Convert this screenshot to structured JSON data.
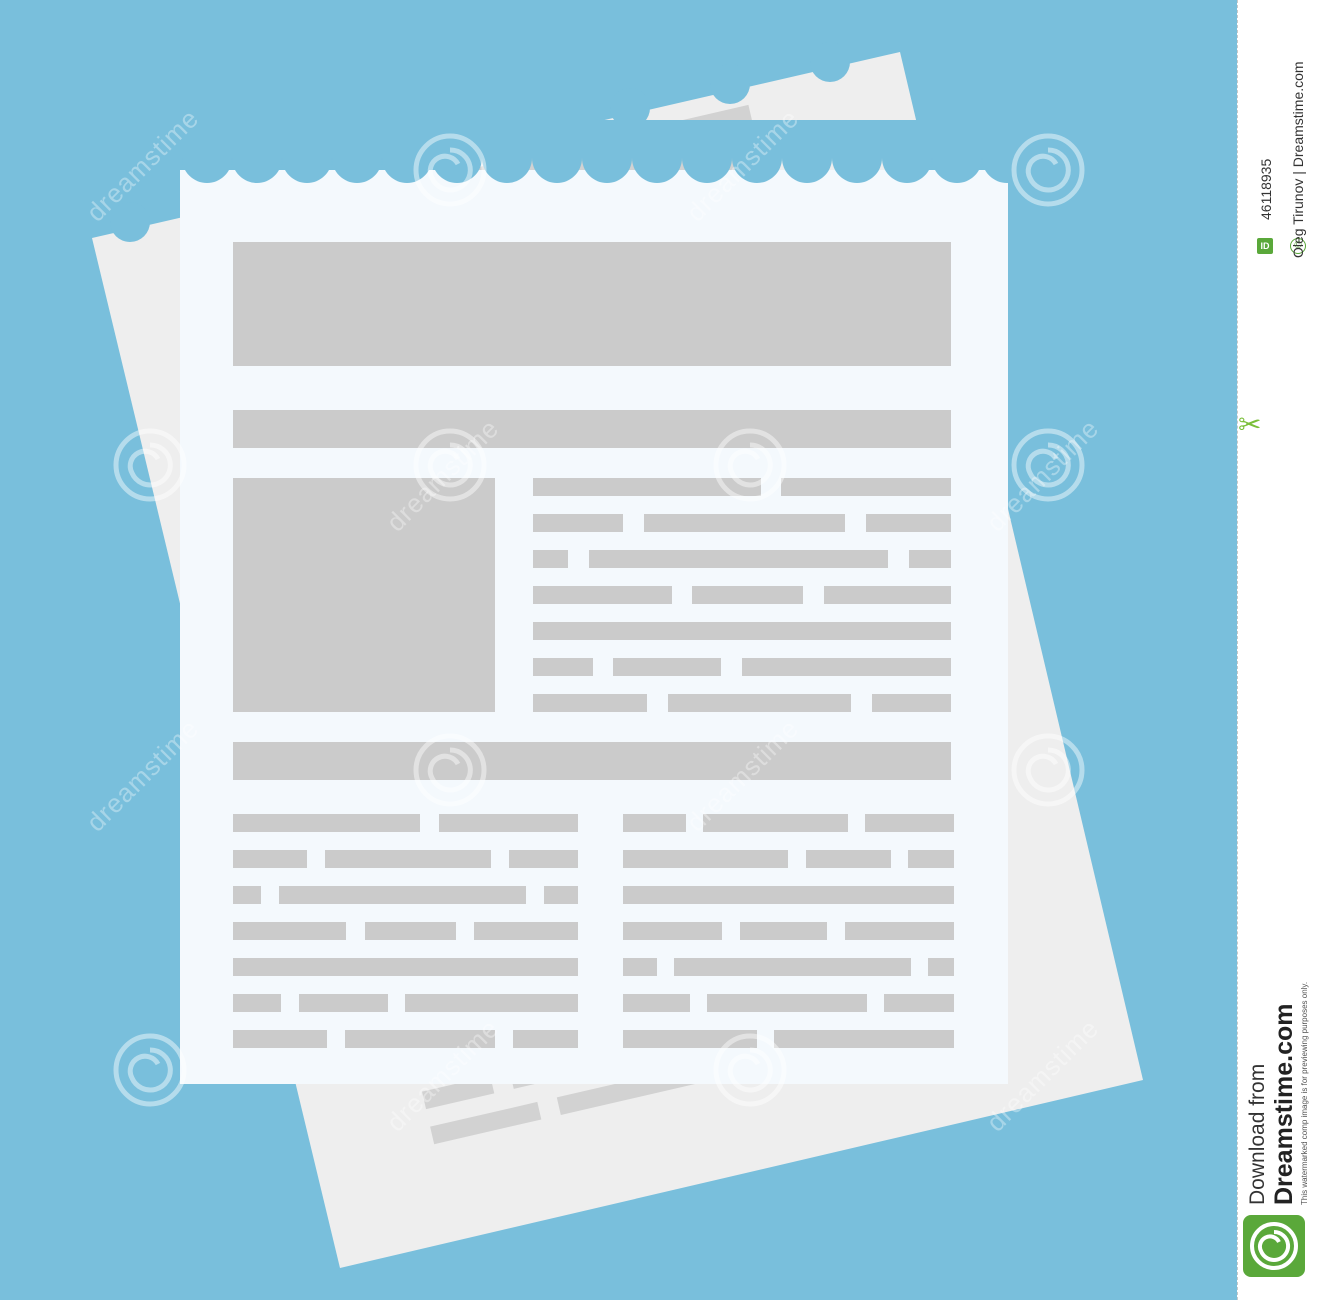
{
  "colors": {
    "background": "#79bfdc",
    "front_sheet": "#f4f9fd",
    "back_sheet": "#efefef",
    "placeholder_block": "#cbcbcb",
    "back_placeholder": "#d2d2d2",
    "brand_green": "#5aa83a"
  },
  "watermark": {
    "text": "dreamstime"
  },
  "credits": {
    "id_badge": "ID",
    "image_id": "46118935",
    "copyright_symbol": "©",
    "author": "Oleg Tirunov | Dreamstime.com",
    "download_from": "Download from",
    "brand": "Dreamstime.com",
    "disclaimer": "This watermarked comp image is for previewing purposes only."
  },
  "icons": {
    "cut_line": "scissors-icon",
    "logo": "dreamstime-swirl-logo-icon",
    "watermark_mark": "swirl-watermark-icon"
  }
}
